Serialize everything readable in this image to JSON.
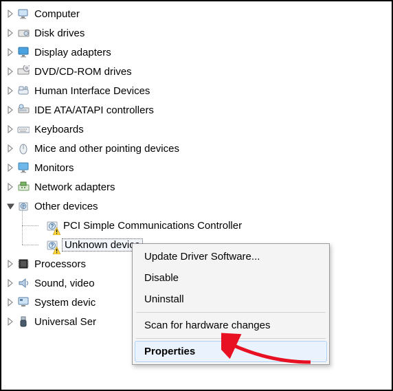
{
  "tree": {
    "computer": "Computer",
    "disk_drives": "Disk drives",
    "display_adapters": "Display adapters",
    "dvd": "DVD/CD-ROM drives",
    "hid": "Human Interface Devices",
    "ide": "IDE ATA/ATAPI controllers",
    "keyboards": "Keyboards",
    "mice": "Mice and other pointing devices",
    "monitors": "Monitors",
    "network": "Network adapters",
    "other": "Other devices",
    "other_children": {
      "pci": "PCI Simple Communications Controller",
      "unknown": "Unknown device"
    },
    "processors": "Processors",
    "sound": "Sound, video",
    "system": "System devic",
    "usb": "Universal Ser"
  },
  "context_menu": {
    "update": "Update Driver Software...",
    "disable": "Disable",
    "uninstall": "Uninstall",
    "scan": "Scan for hardware changes",
    "properties": "Properties"
  }
}
